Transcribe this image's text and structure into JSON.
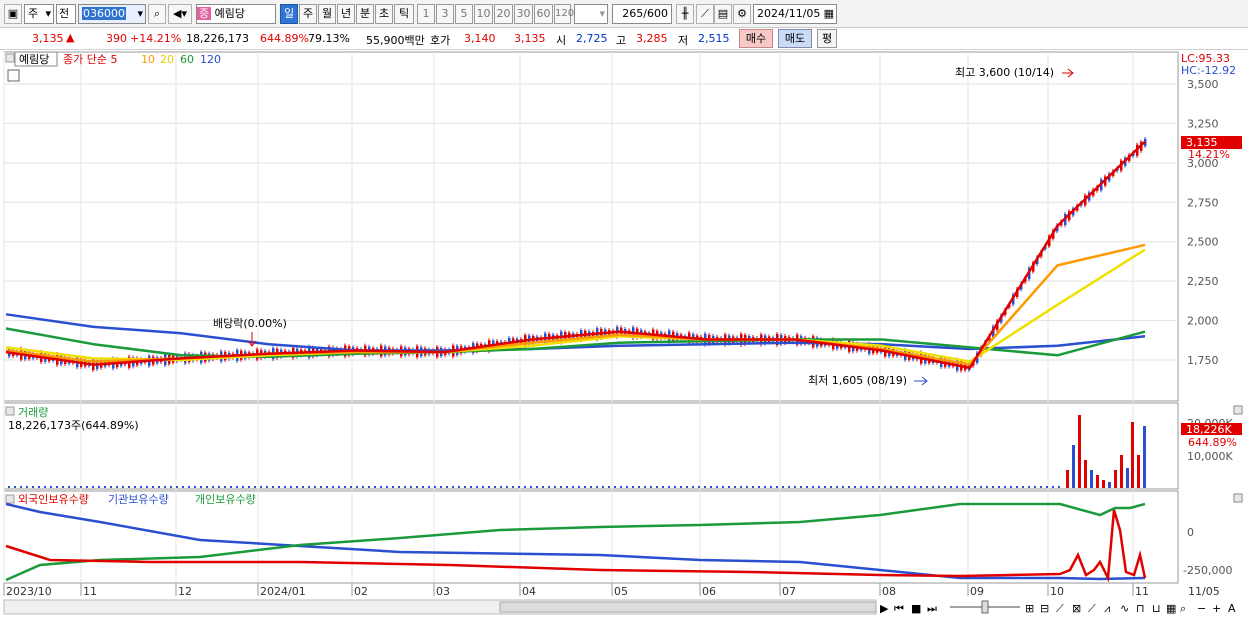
{
  "toolbar": {
    "period_type": "주",
    "prev_label": "전",
    "code": "036000",
    "stock_name_badge": "증",
    "stock_name": "예림당",
    "periods": [
      "일",
      "주",
      "월",
      "년",
      "분",
      "초",
      "틱"
    ],
    "selected_period": "일",
    "intervals": [
      "1",
      "3",
      "5",
      "10",
      "20",
      "30",
      "60",
      "120"
    ],
    "count_value": "265",
    "count_max": "/600",
    "date": "2024/11/05"
  },
  "quote": {
    "price": "3,135",
    "arrow": "▲",
    "change": "390",
    "change_pct": "+14.21%",
    "volume": "18,226,173",
    "volume_ratio": "644.89%",
    "turnover": "79.13%",
    "amount": "55,900백만",
    "bid_label": "호가",
    "bid1": "3,140",
    "bid2": "3,135",
    "open_label": "시",
    "open": "2,725",
    "high_label": "고",
    "high": "3,285",
    "low_label": "저",
    "low": "2,515",
    "buy_label": "매수",
    "sell_label": "매도",
    "extra_label": "평"
  },
  "price_panel": {
    "name": "예림당",
    "ma_title": "종가 단순",
    "ma_periods": [
      "5",
      "10",
      "20",
      "60",
      "120"
    ],
    "lc": "LC:95.33",
    "hc": "HC:-12.92",
    "last_price": "3,135",
    "last_pct": "14.21%",
    "y_ticks": [
      "3,500",
      "3,250",
      "3,000",
      "2,750",
      "2,500",
      "2,250",
      "2,000",
      "1,750"
    ],
    "annotation_high": "최고 3,600 (10/14)",
    "annotation_low": "최저 1,605 (08/19)",
    "annotation_div": "배당락(0.00%)"
  },
  "volume_panel": {
    "title": "거래량",
    "value": "18,226,173주(644.89%)",
    "y_ticks": [
      "20,000K",
      "10,000K"
    ],
    "last": "18,226K",
    "last_pct": "644.89%"
  },
  "holdings_panel": {
    "legend": [
      "외국인보유수량",
      "기관보유수량",
      "개인보유수량"
    ],
    "y_ticks": [
      "0",
      "-250,000"
    ]
  },
  "x_axis": [
    "2023/10",
    "11",
    "12",
    "2024/01",
    "02",
    "03",
    "04",
    "05",
    "06",
    "07",
    "08",
    "09",
    "10",
    "11",
    "11/05"
  ],
  "colors": {
    "ma5": "#e00000",
    "ma10": "#ff9900",
    "ma20": "#f0e000",
    "ma60": "#1a9a3a",
    "ma120": "#2a4fd0",
    "foreign": "#e00000",
    "institution": "#2a4fd0",
    "individual": "#1a9a3a"
  },
  "chart_data": {
    "type": "line",
    "x": [
      "2023/10",
      "11",
      "12",
      "2024/01",
      "02",
      "03",
      "04",
      "05",
      "06",
      "07",
      "08",
      "09",
      "10",
      "11"
    ],
    "series": [
      {
        "name": "종가 단순 5",
        "values": [
          1800,
          1720,
          1760,
          1790,
          1810,
          1800,
          1880,
          1930,
          1880,
          1880,
          1810,
          1700,
          2600,
          3135
        ]
      },
      {
        "name": "10",
        "values": [
          1810,
          1740,
          1760,
          1790,
          1800,
          1800,
          1860,
          1910,
          1880,
          1880,
          1820,
          1720,
          2350,
          2480
        ]
      },
      {
        "name": "20",
        "values": [
          1830,
          1760,
          1750,
          1780,
          1800,
          1800,
          1840,
          1900,
          1880,
          1880,
          1840,
          1740,
          2100,
          2450
        ]
      },
      {
        "name": "60",
        "values": [
          1950,
          1850,
          1780,
          1770,
          1790,
          1800,
          1820,
          1860,
          1870,
          1880,
          1880,
          1830,
          1780,
          1930
        ]
      },
      {
        "name": "120",
        "values": [
          2040,
          1960,
          1920,
          1850,
          1810,
          1810,
          1820,
          1840,
          1850,
          1860,
          1850,
          1820,
          1840,
          1900
        ]
      }
    ],
    "ylim": [
      1600,
      3600
    ],
    "volume": {
      "last": "18,226K",
      "peak": "20,000K"
    },
    "holdings": {
      "series_names": [
        "외국인보유수량",
        "기관보유수량",
        "개인보유수량"
      ]
    }
  }
}
